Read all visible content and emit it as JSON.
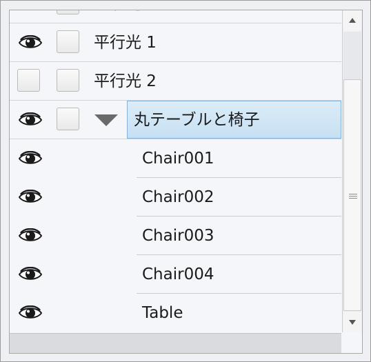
{
  "layers": [
    {
      "label": "環境光",
      "visible": true,
      "type": "light"
    },
    {
      "label": "平行光 1",
      "visible": true,
      "type": "light"
    },
    {
      "label": "平行光 2",
      "visible": false,
      "type": "light"
    },
    {
      "label": "丸テーブルと椅子",
      "visible": true,
      "type": "group",
      "expanded": true,
      "selected": true
    },
    {
      "label": "Chair001",
      "visible": true,
      "type": "child"
    },
    {
      "label": "Chair002",
      "visible": true,
      "type": "child"
    },
    {
      "label": "Chair003",
      "visible": true,
      "type": "child"
    },
    {
      "label": "Chair004",
      "visible": true,
      "type": "child"
    },
    {
      "label": "Table",
      "visible": true,
      "type": "child"
    }
  ],
  "icons": {
    "visibility": "eye-icon",
    "expander": "triangle-down-icon",
    "scroll_up": "arrow-up-icon",
    "scroll_down": "arrow-down-icon"
  },
  "colors": {
    "selection_fill": "#cfe5f5",
    "selection_border": "#86b2d8",
    "background": "#f4f6fa"
  }
}
